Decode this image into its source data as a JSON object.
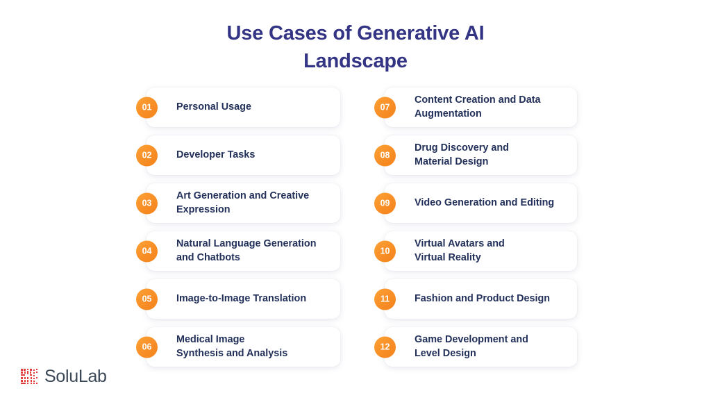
{
  "title": {
    "line1": "Use Cases of Generative AI",
    "line2": "Landscape",
    "color": "#343484"
  },
  "theme": {
    "background": "#ffffff",
    "badge_orange_light": "#fba336",
    "badge_orange_dark": "#f4821a",
    "card_background": "#ffffff",
    "card_text": "#22305a",
    "logo_mark_color": "#e23c3c",
    "logo_text_color": "#3a4756"
  },
  "columns": {
    "left": [
      {
        "number": "01",
        "label": "Personal Usage"
      },
      {
        "number": "02",
        "label": "Developer Tasks"
      },
      {
        "number": "03",
        "label": "Art Generation and Creative\nExpression"
      },
      {
        "number": "04",
        "label": "Natural Language Generation\nand Chatbots"
      },
      {
        "number": "05",
        "label": "Image-to-Image Translation"
      },
      {
        "number": "06",
        "label": "Medical Image\nSynthesis and Analysis"
      }
    ],
    "right": [
      {
        "number": "07",
        "label": "Content Creation and Data\nAugmentation"
      },
      {
        "number": "08",
        "label": "Drug Discovery and\nMaterial Design"
      },
      {
        "number": "09",
        "label": "Video Generation and Editing"
      },
      {
        "number": "10",
        "label": "Virtual Avatars and\nVirtual Reality"
      },
      {
        "number": "11",
        "label": "Fashion and Product Design"
      },
      {
        "number": "12",
        "label": "Game Development and\nLevel Design"
      }
    ]
  },
  "logo": {
    "icon": "solulab-qr-mark-icon",
    "text": "SoluLab"
  }
}
